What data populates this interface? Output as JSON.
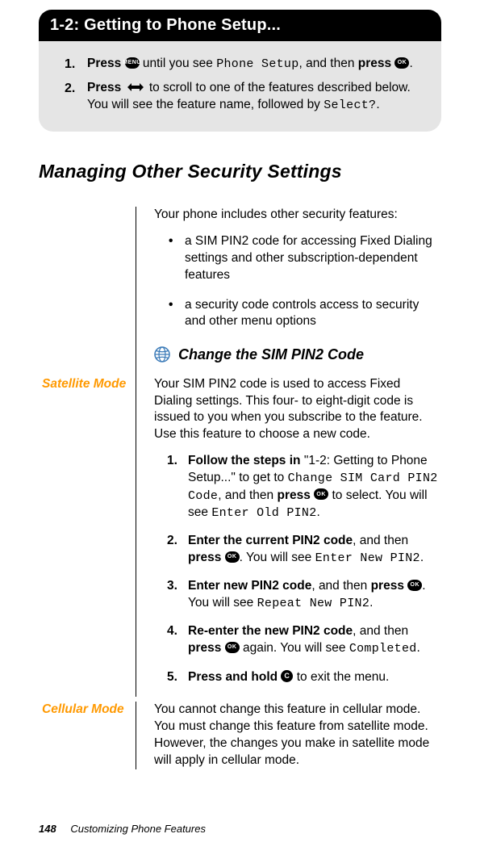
{
  "titlebar": "1-2: Getting to Phone Setup...",
  "greybox": {
    "items": [
      {
        "num": "1.",
        "press1": "Press ",
        "menu_text1": "Phone Setup",
        "mid": " until you see ",
        "tail": ", and then ",
        "press2": "press ",
        "period": "."
      },
      {
        "num": "2.",
        "press1": "Press ",
        "body": " to scroll to one of the features described below. You will see the feature name, followed by ",
        "menu_text1": "Select?",
        "period": "."
      }
    ]
  },
  "h2": "Managing Other Security Settings",
  "intro_para": "Your phone includes other security features:",
  "bullets": [
    "a SIM PIN2 code for accessing Fixed Dialing settings and other subscription-dependent features",
    "a security code controls access to security and other menu options"
  ],
  "subhead": "Change the SIM PIN2 Code",
  "satellite": {
    "label": "Satellite Mode",
    "para": "Your SIM PIN2 code is used to access Fixed Dialing settings. This four- to eight-digit code is issued to you when you subscribe to the feature. Use this feature to choose a new code.",
    "steps": [
      {
        "num": "1.",
        "lead_bold": "Follow the steps in",
        "txt1": " \"1-2: Getting to Phone Setup...\" to get to ",
        "menu1": "Change SIM Card PIN2 Code",
        "txt2": ", and then ",
        "press_bold": "press ",
        "txt3": " to select. You will see ",
        "menu2": "Enter Old PIN2",
        "txt4": "."
      },
      {
        "num": "2.",
        "lead_bold": "Enter the current PIN2 code",
        "txt1": ", and then ",
        "press_bold": "press ",
        "txt2": ". You will see ",
        "menu1": "Enter New PIN2",
        "txt3": "."
      },
      {
        "num": "3.",
        "lead_bold": "Enter new PIN2 code",
        "txt1": ", and then ",
        "press_bold": "press ",
        "txt2": ". You will see ",
        "menu1": "Repeat New PIN2",
        "txt3": "."
      },
      {
        "num": "4.",
        "lead_bold": "Re-enter the new PIN2 code",
        "txt1": ", and then ",
        "press_bold": "press ",
        "txt2": " again. You will see ",
        "menu1": "Completed",
        "txt3": "."
      },
      {
        "num": "5.",
        "lead_bold": "Press and hold ",
        "txt1": " to exit the menu."
      }
    ]
  },
  "cellular": {
    "label": "Cellular Mode",
    "para": "You cannot change this feature in cellular mode. You must change this feature from satellite mode. However, the changes you make in satellite mode will apply in cellular mode."
  },
  "footer": {
    "page": "148",
    "chapter": "Customizing Phone Features"
  },
  "keys": {
    "menu": "MENU",
    "ok": "OK",
    "c": "C"
  }
}
